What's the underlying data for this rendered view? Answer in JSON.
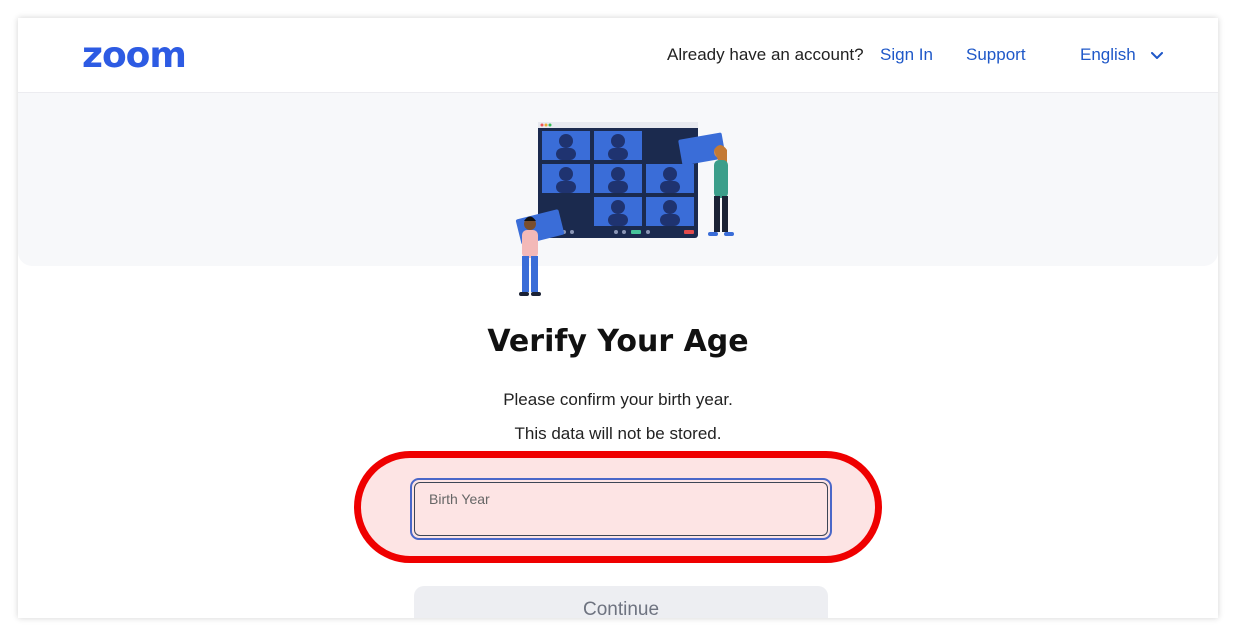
{
  "header": {
    "logo": "zoom",
    "account_prompt": "Already have an account?",
    "sign_in": "Sign In",
    "support": "Support",
    "language": "English"
  },
  "main": {
    "title": "Verify Your Age",
    "line1": "Please confirm your birth year.",
    "line2": "This data will not be stored.",
    "birth_year_label": "Birth Year",
    "birth_year_value": "",
    "continue_label": "Continue"
  },
  "colors": {
    "brand": "#2d5be3",
    "link": "#1f58c8",
    "highlight": "#ef0000"
  }
}
